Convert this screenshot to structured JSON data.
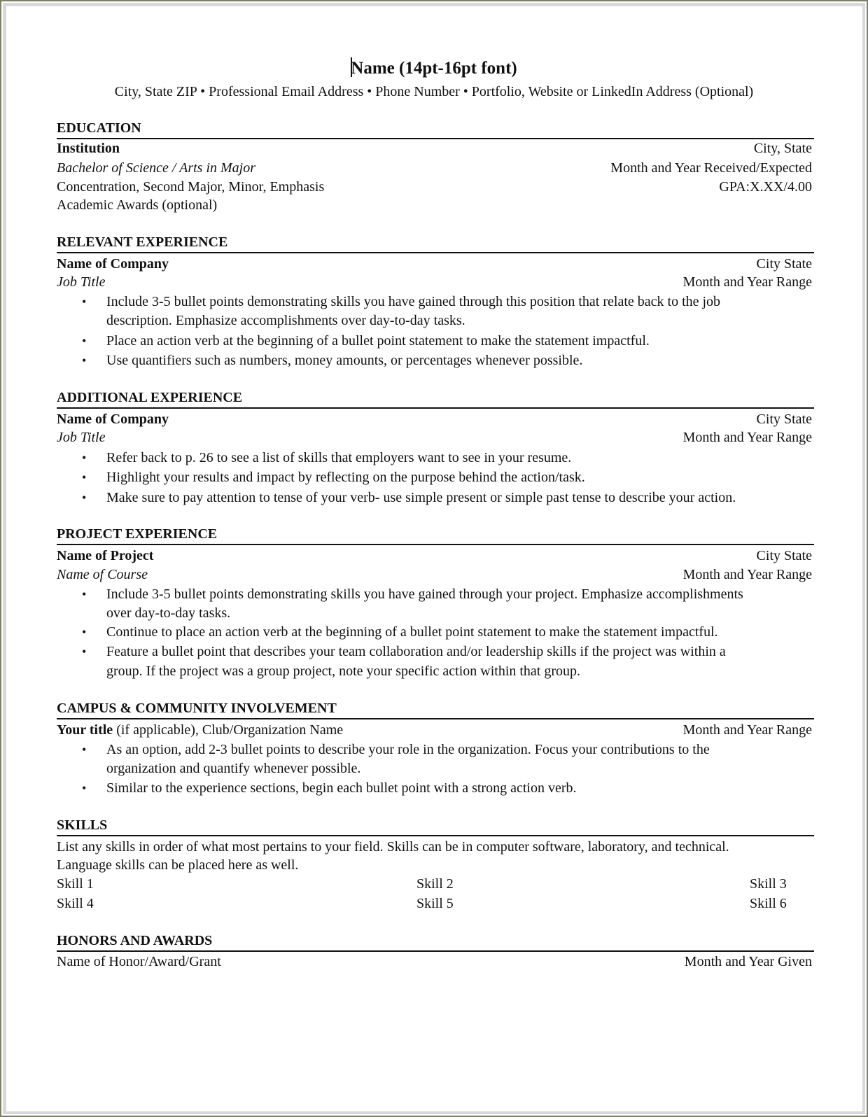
{
  "header": {
    "name": "Name (14pt-16pt font)",
    "contact": "City, State  ZIP • Professional Email Address • Phone Number • Portfolio, Website or LinkedIn Address (Optional)"
  },
  "education": {
    "heading": "EDUCATION",
    "institution": "Institution",
    "location": "City, State",
    "degree": "Bachelor of Science / Arts in Major",
    "date": "Month and Year Received/Expected",
    "concentration": "Concentration, Second Major, Minor, Emphasis",
    "gpa": "GPA:X.XX/4.00",
    "awards": "Academic Awards (optional)"
  },
  "relevant_experience": {
    "heading": "RELEVANT EXPERIENCE",
    "company": "Name of Company",
    "location": "City State",
    "title": "Job Title",
    "date": "Month and Year Range",
    "bullets": [
      {
        "line1": "Include 3-5 bullet points demonstrating skills you have gained through this position that relate back to the job",
        "line2": "description. Emphasize accomplishments over day-to-day tasks."
      },
      {
        "line1": "Place an action verb at the beginning of a bullet point statement to make the statement impactful."
      },
      {
        "line1": "Use quantifiers such as numbers, money amounts, or percentages whenever possible."
      }
    ]
  },
  "additional_experience": {
    "heading": "ADDITIONAL EXPERIENCE",
    "company": "Name of Company",
    "location": "City State",
    "title": "Job Title",
    "date": "Month and Year Range",
    "bullets": [
      {
        "line1": "Refer back to p. 26 to see a list of skills that employers want to see in your resume."
      },
      {
        "line1": "Highlight your results and impact by reflecting on the purpose behind the action/task."
      },
      {
        "line1": "Make sure to pay attention to tense of your verb- use simple present or simple past tense to describe your action."
      }
    ]
  },
  "project_experience": {
    "heading": "PROJECT EXPERIENCE",
    "project": "Name of Project",
    "location": "City State",
    "course": "Name of Course",
    "date": "Month and Year Range",
    "bullets": [
      {
        "line1": "Include 3-5 bullet points demonstrating skills you have gained through your project. Emphasize accomplishments",
        "line2": "over day-to-day tasks."
      },
      {
        "line1": "Continue to place an action verb at the beginning of a bullet point statement to make the statement impactful."
      },
      {
        "line1": "Feature a bullet point that describes your team collaboration and/or leadership skills if the project was within a",
        "line2": "group. If the project was a group project, note your specific action within that group."
      }
    ]
  },
  "involvement": {
    "heading": "CAMPUS & COMMUNITY INVOLVEMENT",
    "title_bold": "Your title",
    "title_rest": " (if applicable), Club/Organization Name",
    "date": "Month and Year Range",
    "bullets": [
      {
        "line1": "As an option, add 2-3 bullet points to describe your role in the organization. Focus your contributions to the",
        "line2": "organization and quantify whenever possible."
      },
      {
        "line1": "Similar to the experience sections, begin each bullet point with a strong action verb."
      }
    ]
  },
  "skills": {
    "heading": "SKILLS",
    "description_line1": "List any skills in order of what most pertains to your field.  Skills can be in computer software, laboratory, and technical.",
    "description_line2": "Language skills can be placed here as well.",
    "items": [
      "Skill 1",
      "Skill 2",
      "Skill 3",
      "Skill 4",
      "Skill 5",
      "Skill 6"
    ]
  },
  "honors": {
    "heading": "HONORS AND AWARDS",
    "name": "Name of Honor/Award/Grant",
    "date": "Month and Year Given"
  },
  "bullet_glyph": "•"
}
